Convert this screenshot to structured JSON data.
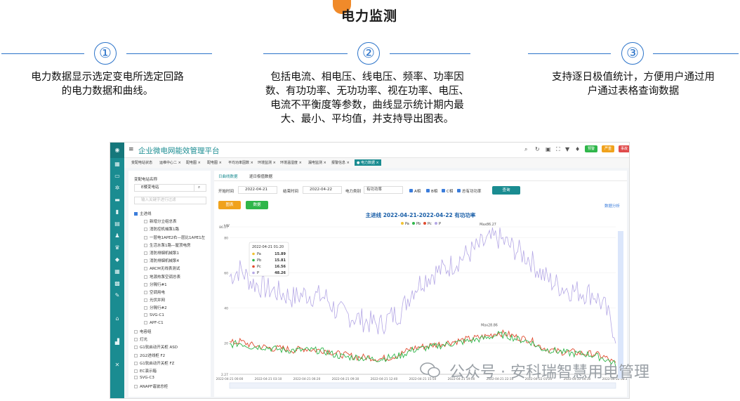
{
  "header": {
    "title": "电力监测"
  },
  "steps": [
    {
      "num": "①",
      "text": [
        "电力数据显示选定变电所选定回路",
        "的电力数据和曲线。"
      ]
    },
    {
      "num": "②",
      "text": [
        "包括电流、相电压、线电压、频率、功率因",
        "数、有功功率、无功功率、视在功率、电压、",
        "电流不平衡度等参数，曲线显示统计期内最",
        "大、最小、平均值，并支持导出图表。"
      ]
    },
    {
      "num": "③",
      "text": [
        "支持逐日极值统计，方便用户通过用",
        "户通过表格查询数据"
      ]
    }
  ],
  "app": {
    "title": "企业微电网能效管理平台",
    "badges": [
      {
        "label": "预警",
        "count": "99+",
        "color": "#2fb64a"
      },
      {
        "label": "严重",
        "count": "99+",
        "color": "#f0a21c"
      },
      {
        "label": "事故",
        "count": "99+",
        "color": "#e04b4b"
      }
    ],
    "tabs": [
      "变配电站状态",
      "运维中心二 ×",
      "配电图 ×",
      "配电图 ×",
      "平均功率因数 ×",
      "环境监测 ×",
      "环境温湿度 ×",
      "漏电监测 ×",
      "报警信息 ×",
      "● 电力数据 ×"
    ],
    "sidebar_icons": [
      "sidebar-logo-icon",
      "dashboard-icon",
      "monitor-icon",
      "settings-icon",
      "folder-icon",
      "chart-icon",
      "document-icon",
      "user-icon",
      "trophy-icon",
      "shield-icon",
      "table-icon",
      "grid-icon",
      "edit-icon",
      "home-icon",
      "analytics-icon",
      "tools-icon"
    ]
  },
  "left_panel": {
    "label": "变配电站名称",
    "station": "E楼变电站",
    "search_placeholder": "输入关键字进行过滤",
    "tree": [
      {
        "text": "主进线",
        "level": 0,
        "checked": true
      },
      {
        "text": "新增分立组总表",
        "level": 1
      },
      {
        "text": "消防控机械泵1路",
        "level": 1
      },
      {
        "text": "一层电1APE2右—层比1APE1左",
        "level": 1
      },
      {
        "text": "生活水泵1路—屋顶电房",
        "level": 1
      },
      {
        "text": "消防排烟机械泵1",
        "level": 1
      },
      {
        "text": "消防排烟机械泵4",
        "level": 1
      },
      {
        "text": "ARCM无线表测试",
        "level": 1
      },
      {
        "text": "地源热泵空调总表",
        "level": 1
      },
      {
        "text": "分隔行#1",
        "level": 1
      },
      {
        "text": "空调用电",
        "level": 1
      },
      {
        "text": "光伏并网",
        "level": 1
      },
      {
        "text": "分隔行#2",
        "level": 1
      },
      {
        "text": "SVG-C1",
        "level": 1
      },
      {
        "text": "APF-C1",
        "level": 1
      },
      {
        "text": "电容组",
        "level": 0
      },
      {
        "text": "灯光",
        "level": 0
      },
      {
        "text": "G1软启动开关柜 ASD",
        "level": 0
      },
      {
        "text": "2G2进线柜 F2",
        "level": 0
      },
      {
        "text": "G1软启动开关柜 FZ",
        "level": 0
      },
      {
        "text": "EC演示箱",
        "level": 0
      },
      {
        "text": "SVG-C3",
        "level": 0
      },
      {
        "text": "ANAPF谐波总柜",
        "level": 0
      }
    ]
  },
  "main": {
    "tabs": [
      "日曲线数据",
      "逐日极值数据"
    ],
    "filters": {
      "start_label": "开始时间",
      "start": "2022-04-21",
      "end_label": "结束时间",
      "end": "2022-04-22",
      "type_label": "电力类别",
      "type": "有功功率",
      "checks": [
        "A相",
        "B相",
        "C相",
        "总有功功率"
      ],
      "query": "查询"
    },
    "buttons": {
      "export": "图表",
      "data": "数据"
    },
    "link": "数据分析"
  },
  "chart_data": {
    "type": "line",
    "title": "主进线  2022-04-21-2022-04-22  有功功率",
    "ylabel": "kW",
    "ylim": [
      2.27,
      86.27
    ],
    "y_ticks": [
      "86.27",
      "80",
      "60",
      "40",
      "20",
      "2.27"
    ],
    "x_ticks": [
      "2022-04-21 00:00",
      "2022-04-21 03:10",
      "2022-04-21 06:20",
      "2022-04-21 09:30",
      "2022-04-21 12:40",
      "2022-04-21 15:50",
      "2022-04-21 19:00",
      "2022-04-21 22:10",
      "2022-04-22 01:20",
      "2022-04-22 04:30",
      "2022-04-22 08:30"
    ],
    "legend": [
      "Pa",
      "Pb",
      "Pc",
      "P"
    ],
    "colors": {
      "Pa": "#f1c232",
      "Pb": "#2fb64a",
      "Pc": "#e04b2f",
      "P": "#b4a7e5"
    },
    "max_label": "Max86.27",
    "max2_label": "Max28.86",
    "tooltip": {
      "time": "2022-04-21 01:20",
      "rows": [
        {
          "name": "Pa",
          "value": "15.89"
        },
        {
          "name": "Pb",
          "value": "15.81"
        },
        {
          "name": "Pc",
          "value": "16.56"
        },
        {
          "name": "P",
          "value": "48.26"
        }
      ]
    },
    "series": [
      {
        "name": "P",
        "values": [
          58,
          62,
          55,
          52,
          50,
          48,
          46,
          48,
          47,
          46,
          38,
          36,
          34,
          32,
          30,
          35,
          38,
          50,
          56,
          60,
          62,
          66,
          70,
          74,
          78,
          80,
          76,
          72,
          68,
          60,
          55,
          52,
          50,
          49,
          48,
          40,
          25
        ]
      },
      {
        "name": "Pc",
        "values": [
          20,
          21,
          19,
          18,
          17,
          17,
          16,
          17,
          16,
          16,
          14,
          13,
          12,
          12,
          11,
          12,
          14,
          17,
          18,
          19,
          20,
          21,
          22,
          23,
          24,
          26,
          25,
          23,
          22,
          18,
          16,
          15,
          15,
          14,
          14,
          12,
          8
        ]
      },
      {
        "name": "Pb",
        "values": [
          19,
          20,
          18,
          18,
          17,
          16,
          16,
          16,
          16,
          15,
          13,
          12,
          12,
          11,
          11,
          12,
          13,
          16,
          17,
          18,
          19,
          20,
          21,
          22,
          23,
          25,
          24,
          22,
          21,
          17,
          16,
          15,
          14,
          14,
          13,
          11,
          8
        ]
      }
    ]
  },
  "watermark": "公众号 · 安科瑞智慧用电管理"
}
